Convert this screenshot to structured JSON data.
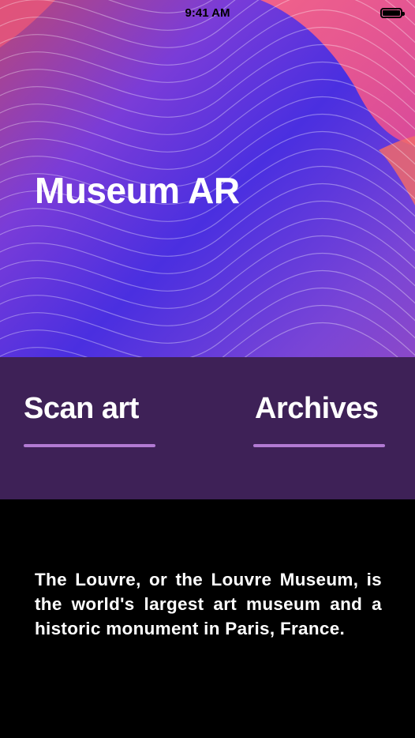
{
  "status_bar": {
    "time": "9:41 AM",
    "battery_icon": "battery-full-icon"
  },
  "hero": {
    "title": "Museum AR",
    "background": "wave-pattern-image",
    "colors": {
      "pink": "#e0558f",
      "violet": "#7a3cd8",
      "blue": "#4a2fe0"
    }
  },
  "tabs": [
    {
      "label": "Scan art"
    },
    {
      "label": "Archives"
    }
  ],
  "tab_accent_color": "#b27ad3",
  "tab_bar_color": "#3e2157",
  "description": "The Louvre, or the Louvre Museum, is the world's largest art museum and a historic monument in Paris, France."
}
